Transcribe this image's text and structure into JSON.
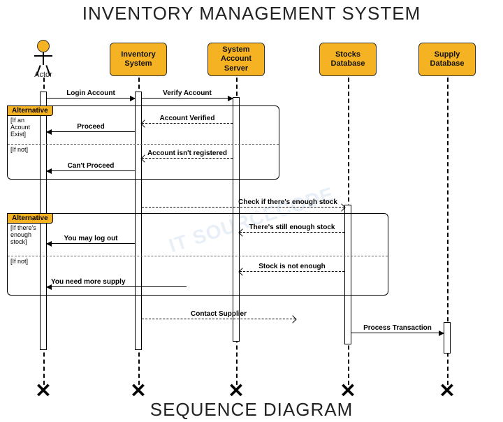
{
  "title": "INVENTORY MANAGEMENT SYSTEM",
  "footer": "SEQUENCE DIAGRAM",
  "watermark": "IT SOURCECODE",
  "participants": {
    "actor": "Actor",
    "p1": "Inventory System",
    "p2": "System Account Server",
    "p3": "Stocks Database",
    "p4": "Supply Database"
  },
  "alt1": {
    "tag": "Alternative",
    "guard1": "[If an Acount Exist]",
    "guard2": "[If not]"
  },
  "alt2": {
    "tag": "Alternative",
    "guard1": "[If there's enough stock]",
    "guard2": "[If not]"
  },
  "messages": {
    "m1": "Login Account",
    "m2": "Verify Account",
    "m3": "Account Verified",
    "m4": "Proceed",
    "m5": "Account isn't registered",
    "m6": "Can't Proceed",
    "m7": "Check if there's enough stock",
    "m8": "There's still enough stock",
    "m9": "You may log out",
    "m10": "Stock is not enough",
    "m11": "You need more supply",
    "m12": "Contact Supplier",
    "m13": "Process Transaction"
  },
  "lanes": {
    "actor": 62,
    "p1": 198,
    "p2": 338,
    "p3": 498,
    "p4": 640
  }
}
